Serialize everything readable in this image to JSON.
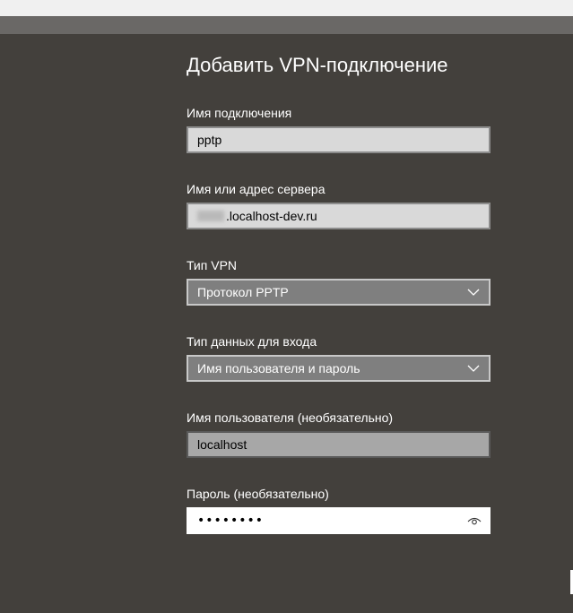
{
  "dialog": {
    "title": "Добавить VPN-подключение"
  },
  "fields": {
    "connection_name": {
      "label": "Имя подключения",
      "value": "pptp"
    },
    "server": {
      "label": "Имя или адрес сервера",
      "value": ".localhost-dev.ru"
    },
    "vpn_type": {
      "label": "Тип VPN",
      "value": "Протокол PPTP"
    },
    "signin_type": {
      "label": "Тип данных для входа",
      "value": "Имя пользователя и пароль"
    },
    "username": {
      "label": "Имя пользователя (необязательно)",
      "value": "localhost"
    },
    "password": {
      "label": "Пароль (необязательно)",
      "value": "••••••••"
    }
  },
  "icons": {
    "dropdown": "chevron-down-icon",
    "reveal": "eye-icon"
  },
  "colors": {
    "panel_bg": "#43403c",
    "field_bg": "#d9d9d9",
    "select_bg": "#7f7f7f"
  }
}
